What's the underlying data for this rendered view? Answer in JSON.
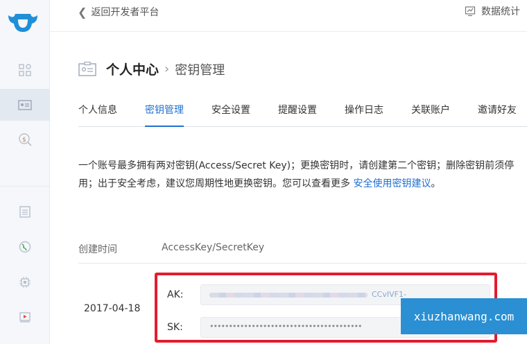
{
  "topbar": {
    "back_label": "返回开发者平台",
    "stats_label": "数据统计"
  },
  "heading": {
    "title": "个人中心",
    "subtitle": "密钥管理"
  },
  "tabs": [
    {
      "label": "个人信息"
    },
    {
      "label": "密钥管理"
    },
    {
      "label": "安全设置"
    },
    {
      "label": "提醒设置"
    },
    {
      "label": "操作日志"
    },
    {
      "label": "关联账户"
    },
    {
      "label": "邀请好友"
    }
  ],
  "active_tab": "密钥管理",
  "description": {
    "text1": "一个账号最多拥有两对密钥(Access/Secret Key)；更换密钥时，请创建第二个密钥；删除密钥前须停",
    "text2": "用；出于安全考虑，建议您周期性地更换密钥。您可以查看更多 ",
    "link": "安全使用密钥建议",
    "end": "。"
  },
  "table": {
    "headers": [
      "创建时间",
      "AccessKey/SecretKey"
    ],
    "rows": [
      {
        "date": "2017-04-18",
        "ak_label": "AK:",
        "ak_visible_tail": "CCvIVF1-",
        "sk_label": "SK:",
        "sk_masked": "••••••••••••••••••••••••••••••••••••••••"
      }
    ]
  },
  "watermark": "xiuzhanwang.com",
  "colors": {
    "accent": "#1f6fd1",
    "highlight_box": "#e31b2e",
    "sidebar_bg": "#f5f7fa"
  }
}
